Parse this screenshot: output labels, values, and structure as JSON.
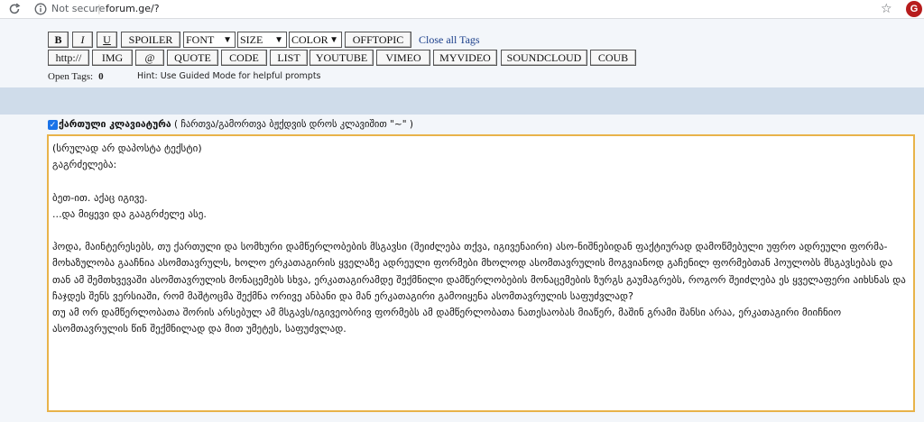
{
  "browser": {
    "security_label": "Not secure",
    "separator": "|",
    "url": "forum.ge/?",
    "profile_initial": "G"
  },
  "toolbar": {
    "row1": [
      {
        "id": "bold",
        "label": "B"
      },
      {
        "id": "italic",
        "label": "I"
      },
      {
        "id": "underline",
        "label": "U"
      },
      {
        "id": "spoiler",
        "label": "SPOILER"
      }
    ],
    "font_select": "FONT",
    "size_select": "SIZE",
    "color_select": "COLOR",
    "offtopic": "OFFTOPIC",
    "close_all_tags": "Close all Tags",
    "row2": [
      "http://",
      "IMG",
      "@",
      "QUOTE",
      "CODE",
      "LIST",
      "YOUTUBE",
      "VIMEO",
      "MYVIDEO",
      "SOUNDCLOUD",
      "COUB"
    ]
  },
  "status": {
    "open_tags_label": "Open Tags:",
    "open_tags_count": "0",
    "hint": "Hint: Use Guided Mode for helpful prompts"
  },
  "keyboard": {
    "checked": true,
    "label": "ქართული კლავიატურა",
    "note": " ( ჩართვა/გამორთვა ბჟქდვის დროს კლავიშით \"~\" )"
  },
  "editor": {
    "text": "(სრულად არ დაპოსტა ტექსტი)\nგაგრძელება:\n\nბეთ-ით. აქაც იგივე.\n...და მიყევი და გააგრძელე ასე.\n\nჰოდა, მაინტერესებს, თუ ქართული და სომხური დამწერლობების მსგავსი (შეიძლება თქვა, იგივენაირი) ასო-ნიშნებიდან ფაქტიურად დამოწმებული უფრო ადრეული ფორმა-მოხაზულობა გააჩნია ასომთავრულს, ხოლო ერკათაგირის ყველაზე ადრეული ფორმები მხოლოდ ასომთავრულის მოგვიანოდ გაჩენილ ფორმებთან ჰოულობს მსგავსებას და თან ამ შემთხვევაში ასომთავრულის მონაცემებს სხვა, ერკათაგირამდე შექმნილი დამწერლობების მონაცემების ზურგს გაუმაგრებს, როგორ შეიძლება ეს ყველაფერი აიხსნას და ჩაჯდეს შენს ვერსიაში, რომ მაშტოცმა შექმნა ორივე ანბანი და მან ერკათაგირი გამოიყენა ასომთავრულის საფუძვლად?\nთუ ამ ორ დამწერლობათა შორის არსებულ ამ მსგავს/იგივეობრივ ფორმებს ამ დამწერლობათა ნათესაობას მიაწერ, მაშინ გრამი შანსი არაა, ერკათაგირი მიიჩნიო ასომთავრულის წინ შექმნილად და მით უმეტეს, საფუძვლად."
  }
}
